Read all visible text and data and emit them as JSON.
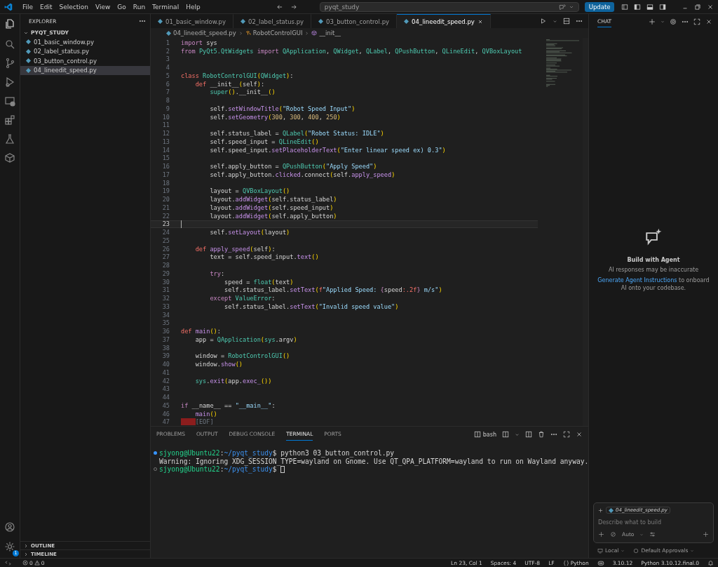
{
  "menu": [
    "File",
    "Edit",
    "Selection",
    "View",
    "Go",
    "Run",
    "Terminal",
    "Help"
  ],
  "command_center": {
    "value": "pyqt_study"
  },
  "update_button": "Update",
  "explorer": {
    "title": "EXPLORER",
    "folder": {
      "name": "PYQT_STUDY",
      "expanded": true,
      "children": [
        {
          "name": "01_basic_window.py",
          "selected": false
        },
        {
          "name": "02_label_status.py",
          "selected": false
        },
        {
          "name": "03_button_control.py",
          "selected": false
        },
        {
          "name": "04_lineedit_speed.py",
          "selected": true
        }
      ]
    },
    "sections": [
      {
        "name": "OUTLINE",
        "expanded": false
      },
      {
        "name": "TIMELINE",
        "expanded": false
      }
    ]
  },
  "settings_badge": "1",
  "tabs": [
    {
      "label": "01_basic_window.py",
      "selected": false
    },
    {
      "label": "02_label_status.py",
      "selected": false
    },
    {
      "label": "03_button_control.py",
      "selected": false
    },
    {
      "label": "04_lineedit_speed.py",
      "selected": true
    }
  ],
  "breadcrumb": [
    {
      "label": "04_lineedit_speed.py",
      "kind": "file"
    },
    {
      "label": "RobotControlGUI",
      "kind": "class"
    },
    {
      "label": "__init__",
      "kind": "method"
    }
  ],
  "editor": {
    "lines": [
      {
        "n": "1",
        "current": false,
        "c": [
          {
            "t": "import",
            "kind": "kw"
          },
          {
            "t": " sys",
            "kind": "pl"
          }
        ]
      },
      {
        "n": "2",
        "current": false,
        "c": [
          {
            "t": "from",
            "kind": "kw"
          },
          {
            "t": " PyQt5.QtWidgets ",
            "kind": "cls"
          },
          {
            "t": "import",
            "kind": "kw"
          },
          {
            "t": " QApplication",
            "kind": "cls"
          },
          {
            "t": ", ",
            "kind": "pl"
          },
          {
            "t": "QWidget",
            "kind": "cls"
          },
          {
            "t": ", ",
            "kind": "pl"
          },
          {
            "t": "QLabel",
            "kind": "cls"
          },
          {
            "t": ", ",
            "kind": "pl"
          },
          {
            "t": "QPushButton",
            "kind": "cls"
          },
          {
            "t": ", ",
            "kind": "pl"
          },
          {
            "t": "QLineEdit",
            "kind": "cls"
          },
          {
            "t": ", ",
            "kind": "pl"
          },
          {
            "t": "QVBoxLayout",
            "kind": "cls"
          }
        ]
      },
      {
        "n": "3",
        "current": false
      },
      {
        "n": "4",
        "current": false
      },
      {
        "n": "5",
        "current": false,
        "c": [
          {
            "t": "class",
            "kind": "def"
          },
          {
            "t": " RobotControlGUI",
            "kind": "cls"
          },
          {
            "t": "(",
            "kind": "p"
          },
          {
            "t": "QWidget",
            "kind": "cls"
          },
          {
            "t": ")",
            "kind": "p"
          },
          {
            "t": ":",
            "kind": "pl"
          }
        ]
      },
      {
        "n": "6",
        "current": false,
        "c": [
          {
            "t": "    def",
            "kind": "def"
          },
          {
            "t": " __init__",
            "kind": "pl"
          },
          {
            "t": "(",
            "kind": "p"
          },
          {
            "t": "self",
            "kind": "pl"
          },
          {
            "t": ")",
            "kind": "p"
          },
          {
            "t": ":",
            "kind": "pl"
          }
        ]
      },
      {
        "n": "7",
        "current": false,
        "c": [
          {
            "t": "        super",
            "kind": "cls"
          },
          {
            "t": "()",
            "kind": "p"
          },
          {
            "t": ".__init__",
            "kind": "pl"
          },
          {
            "t": "()",
            "kind": "p"
          }
        ]
      },
      {
        "n": "8",
        "current": false
      },
      {
        "n": "9",
        "current": false,
        "c": [
          {
            "t": "        self.",
            "kind": "pl"
          },
          {
            "t": "setWindowTitle",
            "kind": "fn"
          },
          {
            "t": "(",
            "kind": "p"
          },
          {
            "t": "\"Robot Speed Input\"",
            "kind": "str"
          },
          {
            "t": ")",
            "kind": "p"
          }
        ]
      },
      {
        "n": "10",
        "current": false,
        "c": [
          {
            "t": "        self.",
            "kind": "pl"
          },
          {
            "t": "setGeometry",
            "kind": "fn"
          },
          {
            "t": "(",
            "kind": "p"
          },
          {
            "t": "300",
            "kind": "num"
          },
          {
            "t": ", ",
            "kind": "pl"
          },
          {
            "t": "300",
            "kind": "num"
          },
          {
            "t": ", ",
            "kind": "pl"
          },
          {
            "t": "400",
            "kind": "num"
          },
          {
            "t": ", ",
            "kind": "pl"
          },
          {
            "t": "250",
            "kind": "num"
          },
          {
            "t": ")",
            "kind": "p"
          }
        ]
      },
      {
        "n": "11",
        "current": false
      },
      {
        "n": "12",
        "current": false,
        "c": [
          {
            "t": "        self.status_label = ",
            "kind": "pl"
          },
          {
            "t": "QLabel",
            "kind": "cls"
          },
          {
            "t": "(",
            "kind": "p"
          },
          {
            "t": "\"Robot Status: IDLE\"",
            "kind": "str"
          },
          {
            "t": ")",
            "kind": "p"
          }
        ]
      },
      {
        "n": "13",
        "current": false,
        "c": [
          {
            "t": "        self.speed_input = ",
            "kind": "pl"
          },
          {
            "t": "QLineEdit",
            "kind": "cls"
          },
          {
            "t": "()",
            "kind": "p"
          }
        ]
      },
      {
        "n": "14",
        "current": false,
        "c": [
          {
            "t": "        self.speed_input.",
            "kind": "pl"
          },
          {
            "t": "setPlaceholderText",
            "kind": "fn"
          },
          {
            "t": "(",
            "kind": "p"
          },
          {
            "t": "\"Enter linear speed ex) 0.3\"",
            "kind": "str"
          },
          {
            "t": ")",
            "kind": "p"
          }
        ]
      },
      {
        "n": "15",
        "current": false
      },
      {
        "n": "16",
        "current": false,
        "c": [
          {
            "t": "        self.apply_button = ",
            "kind": "pl"
          },
          {
            "t": "QPushButton",
            "kind": "cls"
          },
          {
            "t": "(",
            "kind": "p"
          },
          {
            "t": "\"Apply Speed\"",
            "kind": "str"
          },
          {
            "t": ")",
            "kind": "p"
          }
        ]
      },
      {
        "n": "17",
        "current": false,
        "c": [
          {
            "t": "        self.apply_button.",
            "kind": "pl"
          },
          {
            "t": "clicked",
            "kind": "fn"
          },
          {
            "t": ".connect",
            "kind": "pl"
          },
          {
            "t": "(",
            "kind": "p"
          },
          {
            "t": "self.",
            "kind": "pl"
          },
          {
            "t": "apply_speed",
            "kind": "fn"
          },
          {
            "t": ")",
            "kind": "p"
          }
        ]
      },
      {
        "n": "18",
        "current": false
      },
      {
        "n": "19",
        "current": false,
        "c": [
          {
            "t": "        layout = ",
            "kind": "pl"
          },
          {
            "t": "QVBoxLayout",
            "kind": "cls"
          },
          {
            "t": "()",
            "kind": "p"
          }
        ]
      },
      {
        "n": "20",
        "current": false,
        "c": [
          {
            "t": "        layout.",
            "kind": "pl"
          },
          {
            "t": "addWidget",
            "kind": "fn"
          },
          {
            "t": "(",
            "kind": "p"
          },
          {
            "t": "self.status_label",
            "kind": "pl"
          },
          {
            "t": ")",
            "kind": "p"
          }
        ]
      },
      {
        "n": "21",
        "current": false,
        "c": [
          {
            "t": "        layout.",
            "kind": "pl"
          },
          {
            "t": "addWidget",
            "kind": "fn"
          },
          {
            "t": "(",
            "kind": "p"
          },
          {
            "t": "self.speed_input",
            "kind": "pl"
          },
          {
            "t": ")",
            "kind": "p"
          }
        ]
      },
      {
        "n": "22",
        "current": false,
        "c": [
          {
            "t": "        layout.",
            "kind": "pl"
          },
          {
            "t": "addWidget",
            "kind": "fn"
          },
          {
            "t": "(",
            "kind": "p"
          },
          {
            "t": "self.apply_button",
            "kind": "pl"
          },
          {
            "t": ")",
            "kind": "p"
          }
        ]
      },
      {
        "n": "23",
        "current": true
      },
      {
        "n": "24",
        "current": false,
        "c": [
          {
            "t": "        self.",
            "kind": "pl"
          },
          {
            "t": "setLayout",
            "kind": "fn"
          },
          {
            "t": "(",
            "kind": "p"
          },
          {
            "t": "layout",
            "kind": "pl"
          },
          {
            "t": ")",
            "kind": "p"
          }
        ]
      },
      {
        "n": "25",
        "current": false
      },
      {
        "n": "26",
        "current": false,
        "c": [
          {
            "t": "    def",
            "kind": "def"
          },
          {
            "t": " apply_speed",
            "kind": "fn"
          },
          {
            "t": "(",
            "kind": "p"
          },
          {
            "t": "self",
            "kind": "pl"
          },
          {
            "t": ")",
            "kind": "p"
          },
          {
            "t": ":",
            "kind": "pl"
          }
        ]
      },
      {
        "n": "27",
        "current": false,
        "c": [
          {
            "t": "        text = self.speed_input.",
            "kind": "pl"
          },
          {
            "t": "text",
            "kind": "fn"
          },
          {
            "t": "()",
            "kind": "p"
          }
        ]
      },
      {
        "n": "28",
        "current": false
      },
      {
        "n": "29",
        "current": false,
        "c": [
          {
            "t": "        try",
            "kind": "kw"
          },
          {
            "t": ":",
            "kind": "pl"
          }
        ]
      },
      {
        "n": "30",
        "current": false,
        "c": [
          {
            "t": "            speed = ",
            "kind": "pl"
          },
          {
            "t": "float",
            "kind": "cls"
          },
          {
            "t": "(",
            "kind": "p"
          },
          {
            "t": "text",
            "kind": "pl"
          },
          {
            "t": ")",
            "kind": "p"
          }
        ]
      },
      {
        "n": "31",
        "current": false,
        "c": [
          {
            "t": "            self.status_label.",
            "kind": "pl"
          },
          {
            "t": "setText",
            "kind": "fn"
          },
          {
            "t": "(",
            "kind": "p"
          },
          {
            "t": "f",
            "kind": "def"
          },
          {
            "t": "\"Applied Speed: ",
            "kind": "str"
          },
          {
            "t": "{",
            "kind": "kw"
          },
          {
            "t": "speed",
            "kind": "pl"
          },
          {
            "t": ":.2f",
            "kind": "def"
          },
          {
            "t": "}",
            "kind": "kw"
          },
          {
            "t": " m/s\"",
            "kind": "str"
          },
          {
            "t": ")",
            "kind": "p"
          }
        ]
      },
      {
        "n": "32",
        "current": false,
        "c": [
          {
            "t": "        except",
            "kind": "kw"
          },
          {
            "t": " ValueError",
            "kind": "cls"
          },
          {
            "t": ":",
            "kind": "pl"
          }
        ]
      },
      {
        "n": "33",
        "current": false,
        "c": [
          {
            "t": "            self.status_label.",
            "kind": "pl"
          },
          {
            "t": "setText",
            "kind": "fn"
          },
          {
            "t": "(",
            "kind": "p"
          },
          {
            "t": "\"Invalid speed value\"",
            "kind": "str"
          },
          {
            "t": ")",
            "kind": "p"
          }
        ]
      },
      {
        "n": "34",
        "current": false
      },
      {
        "n": "35",
        "current": false
      },
      {
        "n": "36",
        "current": false,
        "c": [
          {
            "t": "def",
            "kind": "def"
          },
          {
            "t": " main",
            "kind": "fn"
          },
          {
            "t": "()",
            "kind": "p"
          },
          {
            "t": ":",
            "kind": "pl"
          }
        ]
      },
      {
        "n": "37",
        "current": false,
        "c": [
          {
            "t": "    app = ",
            "kind": "pl"
          },
          {
            "t": "QApplication",
            "kind": "cls"
          },
          {
            "t": "(",
            "kind": "p"
          },
          {
            "t": "sys",
            "kind": "cls"
          },
          {
            "t": ".argv",
            "kind": "pl"
          },
          {
            "t": ")",
            "kind": "p"
          }
        ]
      },
      {
        "n": "38",
        "current": false
      },
      {
        "n": "39",
        "current": false,
        "c": [
          {
            "t": "    window = ",
            "kind": "pl"
          },
          {
            "t": "RobotControlGUI",
            "kind": "cls"
          },
          {
            "t": "()",
            "kind": "p"
          }
        ]
      },
      {
        "n": "40",
        "current": false,
        "c": [
          {
            "t": "    window.",
            "kind": "pl"
          },
          {
            "t": "show",
            "kind": "fn"
          },
          {
            "t": "()",
            "kind": "p"
          }
        ]
      },
      {
        "n": "41",
        "current": false
      },
      {
        "n": "42",
        "current": false,
        "c": [
          {
            "t": "    sys",
            "kind": "cls"
          },
          {
            "t": ".",
            "kind": "pl"
          },
          {
            "t": "exit",
            "kind": "fn"
          },
          {
            "t": "(",
            "kind": "p"
          },
          {
            "t": "app.",
            "kind": "pl"
          },
          {
            "t": "exec_",
            "kind": "fn"
          },
          {
            "t": "()",
            "kind": "p"
          },
          {
            "t": ")",
            "kind": "p"
          }
        ]
      },
      {
        "n": "43",
        "current": false
      },
      {
        "n": "44",
        "current": false
      },
      {
        "n": "45",
        "current": false,
        "c": [
          {
            "t": "if",
            "kind": "kw"
          },
          {
            "t": " __name__ == ",
            "kind": "pl"
          },
          {
            "t": "\"__main__\"",
            "kind": "str"
          },
          {
            "t": ":",
            "kind": "pl"
          }
        ]
      },
      {
        "n": "46",
        "current": false,
        "c": [
          {
            "t": "    main",
            "kind": "fn"
          },
          {
            "t": "()",
            "kind": "p"
          }
        ]
      },
      {
        "n": "47",
        "current": false,
        "c": [
          {
            "t": "[EOF]",
            "kind": "eof"
          }
        ]
      }
    ]
  },
  "panel": {
    "tabs": [
      {
        "label": "PROBLEMS",
        "selected": false
      },
      {
        "label": "OUTPUT",
        "selected": false
      },
      {
        "label": "DEBUG CONSOLE",
        "selected": false
      },
      {
        "label": "TERMINAL",
        "selected": true
      },
      {
        "label": "PORTS",
        "selected": false
      }
    ],
    "shell": "bash",
    "terminal": [
      {
        "kind": "success",
        "cursor": false,
        "c": [
          {
            "t": "sjyong@Ubuntu22",
            "kind": "user"
          },
          {
            "t": ":",
            "kind": "pl"
          },
          {
            "t": "~/pyqt_study",
            "kind": "path"
          },
          {
            "t": "$ python3 03_button_control.py",
            "kind": "pl"
          }
        ]
      },
      {
        "kind": "output",
        "cursor": false,
        "c": [
          {
            "t": "Warning: Ignoring XDG_SESSION_TYPE=wayland on Gnome. Use QT_QPA_PLATFORM=wayland to run on Wayland anyway.",
            "kind": "pl"
          }
        ]
      },
      {
        "kind": "pending",
        "cursor": true,
        "c": [
          {
            "t": "sjyong@Ubuntu22",
            "kind": "user"
          },
          {
            "t": ":",
            "kind": "pl"
          },
          {
            "t": "~/pyqt_study",
            "kind": "path"
          },
          {
            "t": "$",
            "kind": "pl"
          }
        ]
      }
    ]
  },
  "chat": {
    "title": "CHAT",
    "heading": "Build with Agent",
    "note": "AI responses may be inaccurate",
    "link": "Generate Agent Instructions",
    "link_rest": " to onboard AI onto your codebase.",
    "attachment": "04_lineedit_speed.py",
    "placeholder": "Describe what to build",
    "mode": "Auto",
    "location": "Local",
    "approvals": "Default Approvals"
  },
  "status_bar": {
    "errors": "0",
    "warnings": "0",
    "items": [
      "Ln 23, Col 1",
      "Spaces: 4",
      "UTF-8",
      "LF"
    ],
    "language": "Python",
    "version": "3.10.12",
    "interpreter": "Python 3.10.12.final.0"
  }
}
